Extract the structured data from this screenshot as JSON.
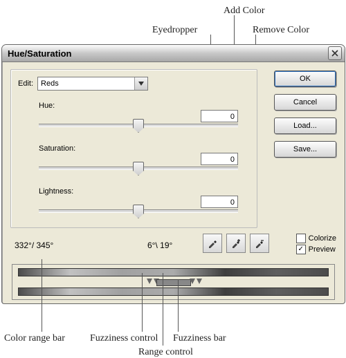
{
  "callouts": {
    "eyedropper": "Eyedropper",
    "add_color": "Add Color",
    "remove_color": "Remove Color",
    "color_range_bar": "Color range bar",
    "fuzziness_control": "Fuzziness control",
    "fuzziness_bar": "Fuzziness bar",
    "range_control": "Range control"
  },
  "dialog": {
    "title": "Hue/Saturation",
    "edit_label": "Edit:",
    "edit_value": "Reds",
    "sliders": {
      "hue_label": "Hue:",
      "hue_value": "0",
      "sat_label": "Saturation:",
      "sat_value": "0",
      "light_label": "Lightness:",
      "light_value": "0"
    },
    "degrees_left": "332°/ 345°",
    "degrees_right": "6°\\ 19°",
    "buttons": {
      "ok": "OK",
      "cancel": "Cancel",
      "load": "Load...",
      "save": "Save..."
    },
    "checks": {
      "colorize": "Colorize",
      "preview": "Preview"
    }
  }
}
